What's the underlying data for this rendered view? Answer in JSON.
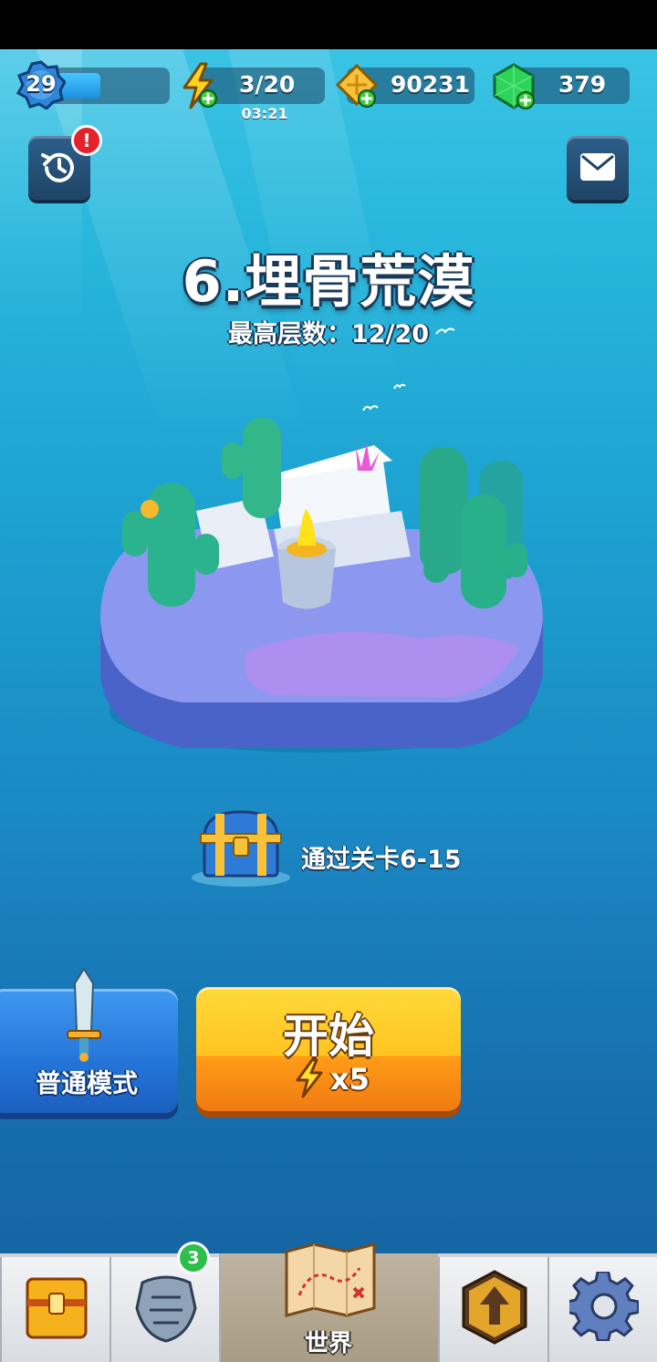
{
  "hud": {
    "level": "29",
    "xp_fraction": 0.4,
    "energy": "3/20",
    "energy_timer": "03:21",
    "coins": "90231",
    "gems": "379"
  },
  "stage": {
    "title": "6.埋骨荒漠",
    "best_floor": "最高层数：12/20"
  },
  "reward": {
    "requirement": "通过关卡6-15"
  },
  "actions": {
    "mode_label": "普通模式",
    "start_label": "开始",
    "start_cost": "x5"
  },
  "alerts": {
    "history_alert": "!"
  },
  "nav": {
    "equipment_badge": "3",
    "world_label": "世界"
  },
  "colors": {
    "start_button": "#ffc521",
    "mode_button": "#2474d8",
    "alert": "#e3222c",
    "badge": "#2dbf4a"
  },
  "icons": [
    "level-badge-icon",
    "energy-icon",
    "coin-icon",
    "gem-icon",
    "history-icon",
    "mail-icon",
    "treasure-chest-icon",
    "sword-icon",
    "lightning-icon",
    "chest-nav-icon",
    "armor-icon",
    "map-icon",
    "upgrade-icon",
    "settings-icon"
  ]
}
